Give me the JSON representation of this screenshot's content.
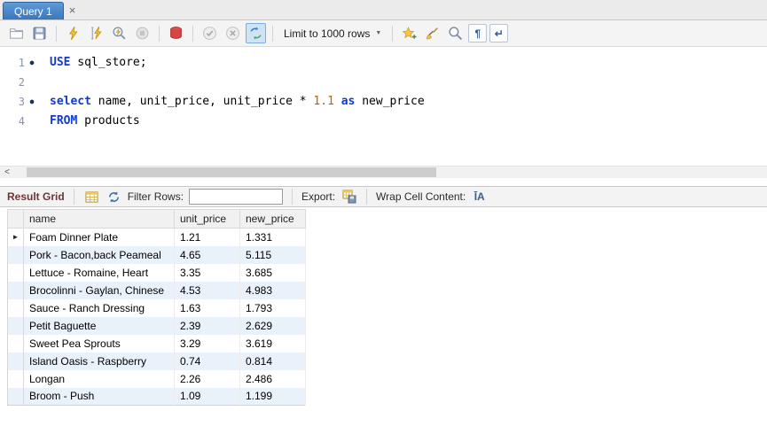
{
  "tabbar": {
    "tabs": [
      {
        "label": "Query 1",
        "active": true
      }
    ]
  },
  "icons": {
    "close": "×",
    "dropdown_arrow": "▼",
    "scroll_left_arrow": "<",
    "statement_dot": "●",
    "current_row_marker": "►",
    "pilcrow": "¶",
    "wrap_return": "↵",
    "wrap_cell_glyph": "ĪA",
    "toolbar_icon_names": [
      "open-file",
      "save",
      "execute-all",
      "execute-current",
      "explain-plan",
      "stop-query",
      "toggle-stop-on-error",
      "commit",
      "rollback",
      "toggle-autocommit",
      "limit-rows-dropdown",
      "save-snippet",
      "beautify-query",
      "find",
      "toggle-invisible-chars",
      "toggle-word-wrap"
    ],
    "result_toolbar_icon_names": [
      "result-grid",
      "refresh",
      "export-recordset",
      "wrap-cell-content"
    ]
  },
  "toolbar": {
    "limit_label": "Limit to 1000 rows"
  },
  "editor": {
    "lines": [
      {
        "num": "1",
        "marker": true,
        "tokens": [
          {
            "text": "USE",
            "type": "kw"
          },
          {
            "text": " sql_store;",
            "type": "plain"
          }
        ]
      },
      {
        "num": "2",
        "marker": false,
        "tokens": []
      },
      {
        "num": "3",
        "marker": true,
        "tokens": [
          {
            "text": "select",
            "type": "kw"
          },
          {
            "text": " name, unit_price, unit_price * ",
            "type": "plain"
          },
          {
            "text": "1.1",
            "type": "num"
          },
          {
            "text": " ",
            "type": "plain"
          },
          {
            "text": "as",
            "type": "kw"
          },
          {
            "text": " new_price",
            "type": "plain"
          }
        ]
      },
      {
        "num": "4",
        "marker": false,
        "tokens": [
          {
            "text": "FROM",
            "type": "kw"
          },
          {
            "text": " products",
            "type": "plain"
          }
        ]
      }
    ]
  },
  "result_toolbar": {
    "title": "Result Grid",
    "filter_label": "Filter Rows:",
    "filter_value": "",
    "export_label": "Export:",
    "wrap_label": "Wrap Cell Content:"
  },
  "grid": {
    "columns": [
      "name",
      "unit_price",
      "new_price"
    ],
    "rows": [
      [
        "Foam Dinner Plate",
        "1.21",
        "1.331"
      ],
      [
        "Pork - Bacon,back Peameal",
        "4.65",
        "5.115"
      ],
      [
        "Lettuce - Romaine, Heart",
        "3.35",
        "3.685"
      ],
      [
        "Brocolinni - Gaylan, Chinese",
        "4.53",
        "4.983"
      ],
      [
        "Sauce - Ranch Dressing",
        "1.63",
        "1.793"
      ],
      [
        "Petit Baguette",
        "2.39",
        "2.629"
      ],
      [
        "Sweet Pea Sprouts",
        "3.29",
        "3.619"
      ],
      [
        "Island Oasis - Raspberry",
        "0.74",
        "0.814"
      ],
      [
        "Longan",
        "2.26",
        "2.486"
      ],
      [
        "Broom - Push",
        "1.09",
        "1.199"
      ]
    ]
  },
  "colors": {
    "keyword": "#0f3bd2",
    "number_literal": "#c06000",
    "active_tab": "#3c78b8",
    "active_tab_top": "#5e9ad8",
    "alt_row": "#e9f1fb"
  }
}
